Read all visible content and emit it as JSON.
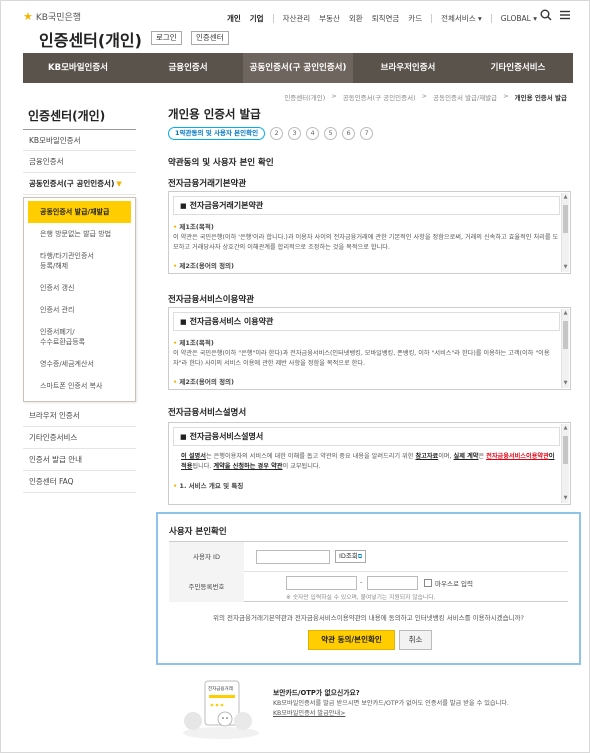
{
  "header": {
    "bank_name": "KB국민은행",
    "site_title": "인증센터(개인)",
    "login_label": "로그인",
    "cert_center_label": "인증센터",
    "top_nav": [
      "개인",
      "기업",
      "자산관리",
      "부동산",
      "외환",
      "퇴직연금",
      "카드",
      "전체서비스 ▾",
      "GLOBAL ▾"
    ]
  },
  "gnb": [
    "KB모바일인증서",
    "금융인증서",
    "공동인증서(구 공인인증서)",
    "브라우저인증서",
    "기타인증서비스"
  ],
  "breadcrumb": [
    "인증센터(개인)",
    "공동인증서(구 공인인증서)",
    "공동인증서 발급/재발급",
    "개인용 인증서 발급"
  ],
  "lnb": {
    "title": "인증센터(개인)",
    "items": [
      "KB모바일인증서",
      "금융인증서",
      "공동인증서(구 공인인증서)"
    ],
    "sub_items": [
      "공동인증서 발급/재발급",
      "은행 방문없는 발급 방법",
      "타행/타기관인증서\n등록/해제",
      "인증서 갱신",
      "인증서 관리",
      "인증서폐기/\n수수료환급등록",
      "영수증/세금계산서",
      "스마트폰 인증서 복사"
    ],
    "items_after": [
      "브라우저 인증서",
      "기타인증서비스",
      "인증서 발급 안내",
      "인증센터 FAQ"
    ]
  },
  "main": {
    "page_title": "개인용 인증서 발급",
    "step1_label": "1약관동의 및 사용자 본인확인",
    "steps": [
      "2",
      "3",
      "4",
      "5",
      "6",
      "7"
    ],
    "section_title": "약관동의 및 사용자 본인 확인",
    "term1": {
      "title": "전자금융거래기본약관",
      "box_title": "전자금융거래기본약관",
      "art1": "제1조(목적)",
      "text1": "이 약관은 국민은행(이하 '은행'이라 합니다.)과 이용자 사이의 전자금융거래에 관한 기본적인 사항을 정함으로써, 거래의 신속하고 효율적인 처리를 도모하고 거래당사자 상호간의 이해관계를 합리적으로 조정하는 것을 목적으로 합니다.",
      "art2": "제2조(용어의 정의)"
    },
    "term2": {
      "title": "전자금융서비스이용약관",
      "box_title": "전자금융서비스 이용약관",
      "art1": "제1조(목적)",
      "text1": "이 약관은 국민은행(이하 \"은행\"이라 한다)과 전자금융서비스(인터넷뱅킹, 모바일뱅킹, 폰뱅킹, 이하 \"서비스\"라 한다)를 이용하는 고객(이하 \"이용자\"라 한다) 사이의 서비스 이용에 관한 제반 사항을 정함을 목적으로 한다.",
      "art2": "제2조(용어의 정의)"
    },
    "term3": {
      "title": "전자금융서비스설명서",
      "box_title": "전자금융서비스설명서",
      "t_a": "이 설명서",
      "t_b": "는 은행이용자의 서비스에 대한 이해를 돕고 약관의 중요 내용을 알려드리기 위한 ",
      "t_c": "참고자료",
      "t_d": "이며, ",
      "t_e": "실제 계약",
      "t_f": "은 ",
      "t_g": "전자금융서비스이용약관",
      "t_h": "이 적용",
      "t_i": "됩니다. ",
      "t_j": "계약을 신청하는 경우 약관",
      "t_k": "이 교부됩니다.",
      "art1": "1. 서비스 개요 및 특징"
    },
    "confirm": {
      "title": "사용자 본인확인",
      "user_id_label": "사용자 ID",
      "id_lookup_label": "ID조회",
      "resident_label": "주민등록번호",
      "dash": "-",
      "masking_label": "마우스로 입력",
      "note": "※ 숫자만 입력하실 수 있으며, 붙여넣기는 지원되지 않습니다.",
      "question": "위의 전자금융거래기본약관과 전자금융서비스이용약관의 내용에 동의하고 인터넷뱅킹 서비스를 이용하시겠습니까?",
      "agree_button": "약관 동의/본인확인",
      "cancel_button": "취소"
    },
    "promo": {
      "card_label": "전자금융거래",
      "line1": "보안카드/OTP가 없으신가요?",
      "line2": "KB모바일인증서를 발급 받으시면 보안카드/OTP가 없어도 인증서를 발급 받을 수 있습니다.",
      "link": "KB모바일인증서 발급안내>"
    }
  },
  "colors": {
    "gnb_bg": "#5a534c",
    "accent_yellow": "#ffcd00",
    "confirm_border": "#8fc3ea"
  }
}
